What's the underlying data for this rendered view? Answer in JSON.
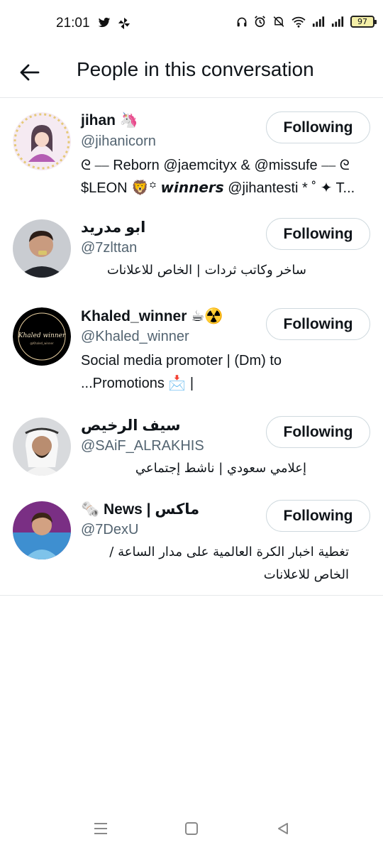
{
  "status_bar": {
    "time": "21:01",
    "battery": "97",
    "left_icons": [
      "twitter-bird-icon",
      "pinwheel-icon"
    ],
    "right_icons": [
      "headphones-icon",
      "alarm-icon",
      "mute-icon",
      "wifi-icon",
      "signal-icon",
      "signal-icon",
      "battery-icon"
    ]
  },
  "header": {
    "title": "People in this conversation",
    "back_icon": "arrow-left-icon"
  },
  "people": [
    {
      "name": "jihan 🦄",
      "handle": "@jihanicorn",
      "bio_line1": "ᘓ ⎯⎯ Reborn @jaemcityx & @missufe ⎯⎯ ᘓ",
      "bio_line2": "$LEON 🦁꙳ 𝙬𝙞𝙣𝙣𝙚𝙧𝙨 @jihantesti * ˚ ✦ T...",
      "button": "Following"
    },
    {
      "name": "ابو مدريد",
      "handle": "@7zlttan",
      "bio_line1": "ساخر وكاتب ثردات | الخاص للاعلانات",
      "bio_line2": "",
      "button": "Following"
    },
    {
      "name": "Khaled_winner ☕☢️",
      "handle": "@Khaled_winner",
      "bio_line1": "Social media promoter | (Dm) to",
      "bio_line2": "...Promotions 📩 |",
      "button": "Following"
    },
    {
      "name": "سيف الرخيص",
      "handle": "@SAiF_ALRAKHIS",
      "bio_line1": "إعلامي سعودي | ناشط إجتماعي",
      "bio_line2": "",
      "button": "Following"
    },
    {
      "name": "ماكس | News 🗞️",
      "handle": "@7DexU",
      "bio_line1": "تغطية اخبار الكرة العالمية على مدار الساعة /",
      "bio_line2": "الخاص للاعلانات",
      "button": "Following"
    }
  ],
  "nav": {
    "items": [
      "menu-icon",
      "home-square-icon",
      "back-triangle-icon"
    ]
  }
}
